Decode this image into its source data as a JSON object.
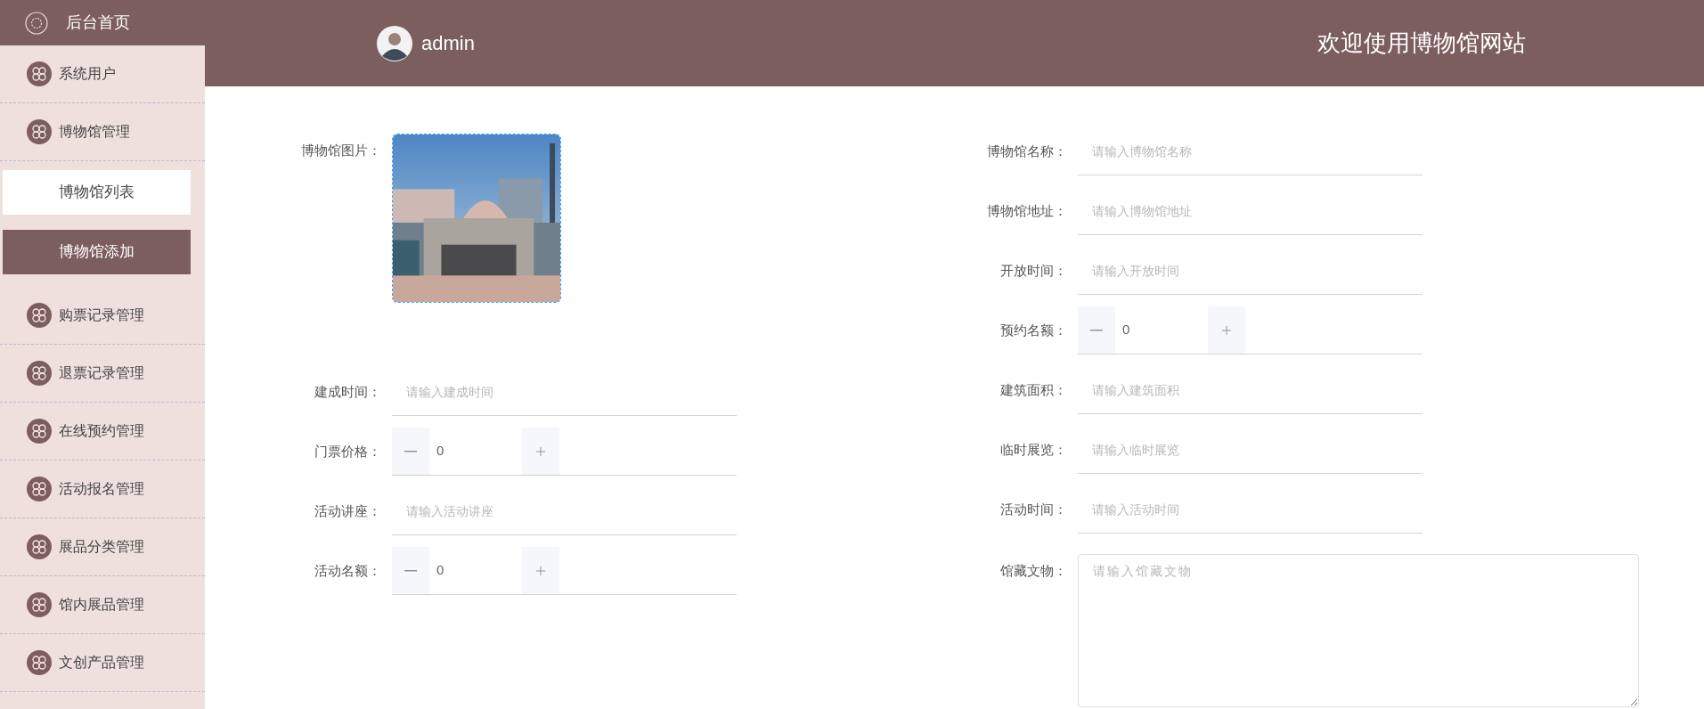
{
  "header": {
    "user": "admin",
    "title": "欢迎使用博物馆网站"
  },
  "sidebar": {
    "home": {
      "label": "后台首页"
    },
    "items": [
      {
        "label": "系统用户"
      },
      {
        "label": "博物馆管理",
        "children": [
          {
            "label": "博物馆列表",
            "selected": false
          },
          {
            "label": "博物馆添加",
            "selected": true
          }
        ]
      },
      {
        "label": "购票记录管理"
      },
      {
        "label": "退票记录管理"
      },
      {
        "label": "在线预约管理"
      },
      {
        "label": "活动报名管理"
      },
      {
        "label": "展品分类管理"
      },
      {
        "label": "馆内展品管理"
      },
      {
        "label": "文创产品管理"
      }
    ]
  },
  "form": {
    "left": [
      {
        "label": "博物馆图片："
      },
      {
        "kind": "text",
        "label": "建成时间：",
        "placeholder": "请输入建成时间"
      },
      {
        "kind": "number",
        "label": "门票价格：",
        "value": "0"
      },
      {
        "kind": "text",
        "label": "活动讲座：",
        "placeholder": "请输入活动讲座"
      },
      {
        "kind": "number",
        "label": "活动名额：",
        "value": "0"
      }
    ],
    "right": [
      {
        "kind": "text",
        "label": "博物馆名称：",
        "placeholder": "请输入博物馆名称"
      },
      {
        "kind": "text",
        "label": "博物馆地址：",
        "placeholder": "请输入博物馆地址"
      },
      {
        "kind": "text",
        "label": "开放时间：",
        "placeholder": "请输入开放时间"
      },
      {
        "kind": "number",
        "label": "预约名额：",
        "value": "0"
      },
      {
        "kind": "text",
        "label": "建筑面积：",
        "placeholder": "请输入建筑面积"
      },
      {
        "kind": "text",
        "label": "临时展览：",
        "placeholder": "请输入临时展览"
      },
      {
        "kind": "text",
        "label": "活动时间：",
        "placeholder": "请输入活动时间"
      },
      {
        "kind": "textarea",
        "label": "馆藏文物：",
        "placeholder": "请输入馆藏文物"
      }
    ]
  }
}
